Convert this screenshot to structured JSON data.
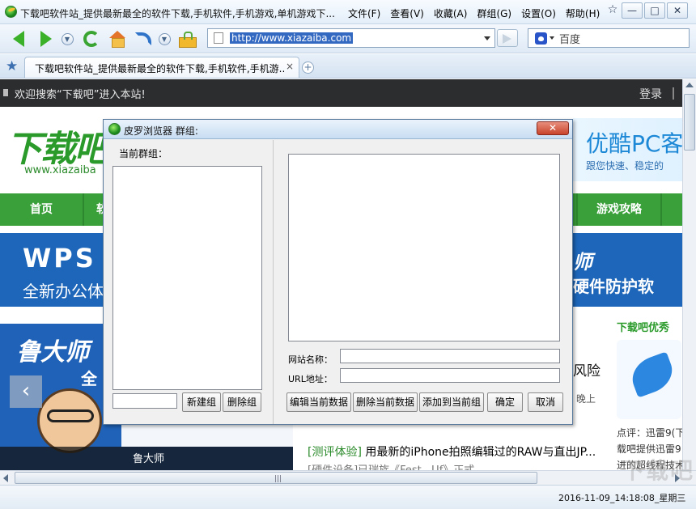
{
  "window": {
    "title": "下载吧软件站_提供最新最全的软件下载,手机软件,手机游戏,单机游戏下...",
    "menu": [
      "文件(F)",
      "查看(V)",
      "收藏(A)",
      "群组(G)",
      "设置(O)",
      "帮助(H)"
    ],
    "controls": {
      "min": "—",
      "max": "□",
      "close": "✕",
      "skin": "☆"
    }
  },
  "toolbar": {
    "url": "http://www.xiazaiba.com",
    "search_text": "百度"
  },
  "tabs": [
    {
      "title": "下载吧软件站_提供最新最全的软件下载,手机软件,手机游...",
      "close": "×"
    }
  ],
  "newtab": "+",
  "page": {
    "welcome": "欢迎搜索“下载吧”进入本站!",
    "login": "登录",
    "logo_text": "下载吧",
    "logo_url": "www.xiazaiba",
    "ad_right_big": "优酷PC客",
    "ad_right_small": "跟您快速、稳定的",
    "nav": [
      "首页",
      "软",
      "游戏攻略"
    ],
    "banner_l1": "WPS",
    "banner_l2": "全新办公体",
    "banner_r1": "师",
    "banner_r2": "硬件防护软",
    "slider_t1": "鲁大师",
    "slider_t2": "全",
    "slider_prev": "‹",
    "slider_caption": "鲁大师",
    "side_title": "下载吧优秀",
    "risk_text": "风险",
    "late_text": "晚上",
    "side_lines": [
      "点评：迅雷9(下",
      "载吧提供迅雷9",
      "进的超线程技术"
    ],
    "news1_tag": "[测评体验]",
    "news1_text": "用最新的iPhone拍照编辑过的RAW与直出JP...",
    "news2_text": "[硬件设备]已瑞族《Fest...Uf》正式...",
    "watermark": "下载吧"
  },
  "status": {
    "datetime": "2016-11-09_14:18:08_星期三"
  },
  "dialog": {
    "title": "皮罗浏览器 群组:",
    "close": "✕",
    "current_group_label": "当前群组：",
    "group_name_value": "",
    "new_group_button": "新建组",
    "delete_group_button": "删除组",
    "site_name_label": "网站名称：",
    "site_name_value": "",
    "url_label": "URL地址：",
    "url_value": "",
    "edit_button": "编辑当前数据",
    "delete_data_button": "删除当前数据",
    "add_button": "添加到当前组",
    "ok_button": "确定",
    "cancel_button": "取消"
  }
}
